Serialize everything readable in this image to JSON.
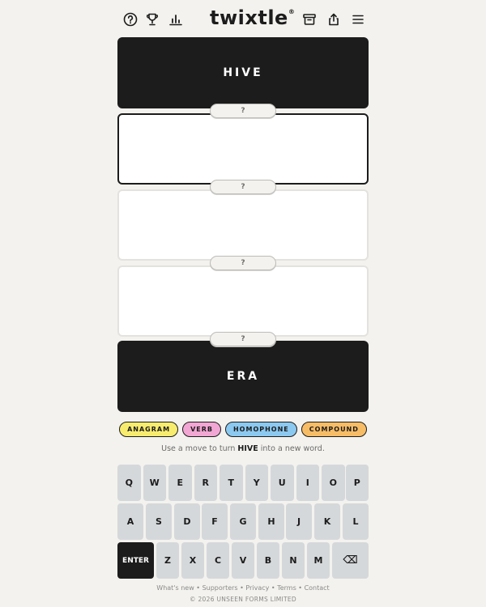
{
  "header": {
    "logo_text": "twixtle",
    "logo_mark": "®",
    "left_icons": [
      "help-icon",
      "trophy-icon",
      "stats-icon"
    ],
    "right_icons": [
      "archive-icon",
      "share-icon",
      "menu-icon"
    ]
  },
  "puzzle": {
    "start_word": "HIVE",
    "end_word": "ERA",
    "move_placeholder": "?"
  },
  "moves": [
    {
      "label": "ANAGRAM",
      "color": "#f7ec6e"
    },
    {
      "label": "VERB",
      "color": "#f2a6d3"
    },
    {
      "label": "HOMOPHONE",
      "color": "#8cc9f0"
    },
    {
      "label": "COMPOUND",
      "color": "#f7bc66"
    }
  ],
  "hint": {
    "prefix": "Use a move to turn ",
    "word": "HIVE",
    "suffix": " into a new word."
  },
  "keyboard": {
    "row1": [
      "Q",
      "W",
      "E",
      "R",
      "T",
      "Y",
      "U",
      "I",
      "O",
      "P"
    ],
    "row2": [
      "A",
      "S",
      "D",
      "F",
      "G",
      "H",
      "J",
      "K",
      "L"
    ],
    "row3": [
      "ENTER",
      "Z",
      "X",
      "C",
      "V",
      "B",
      "N",
      "M",
      "⌫"
    ]
  },
  "footer": {
    "links": [
      "What's new",
      "Supporters",
      "Privacy",
      "Terms",
      "Contact"
    ],
    "separator": " • ",
    "copyright": "© 2026 UNSEEN FORMS LIMITED"
  }
}
